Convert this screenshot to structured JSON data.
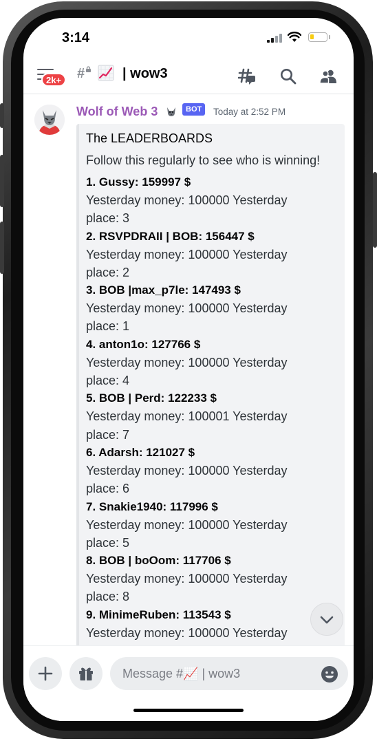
{
  "status_bar": {
    "time": "3:14",
    "battery_level": 0.25
  },
  "header": {
    "menu_badge": "2k+",
    "channel_hash": "#",
    "channel_emoji": "chart-increasing-icon",
    "channel_name": "| wow3",
    "icons": [
      "threads-icon",
      "search-icon",
      "members-icon"
    ]
  },
  "message": {
    "author": "Wolf of Web 3",
    "author_color": "#9b59b6",
    "author_emoji": "wolf-icon",
    "bot_tag": "BOT",
    "timestamp": "Today at 2:52 PM",
    "embed": {
      "title": "The LEADERBOARDS",
      "description": "Follow this regularly to see who is winning!",
      "entries": [
        {
          "name": "1. Gussy: 159997 $",
          "detail": "Yesterday money:  100000 Yesterday place:  3"
        },
        {
          "name": "2. RSVPDRAII | BOB: 156447 $",
          "detail": "Yesterday money:  100000 Yesterday place:  2"
        },
        {
          "name": "3. BOB |max_p7le: 147493 $",
          "detail": "Yesterday money:  100000 Yesterday place:  1"
        },
        {
          "name": "4. anton1o: 127766 $",
          "detail": "Yesterday money:  100000 Yesterday place:  4"
        },
        {
          "name": "5. BOB | Perd: 122233 $",
          "detail": "Yesterday money:  100001 Yesterday place:  7"
        },
        {
          "name": "6. Adarsh: 121027 $",
          "detail": "Yesterday money:  100000 Yesterday place:  6"
        },
        {
          "name": "7. Snakie1940: 117996 $",
          "detail": "Yesterday money:  100000 Yesterday place:  5"
        },
        {
          "name": "8. BOB | boOom: 117706 $",
          "detail": "Yesterday money:  100000 Yesterday place:  8"
        },
        {
          "name": "9. MinimeRuben: 113543 $",
          "detail": "Yesterday money:  100000 Yesterday"
        }
      ]
    }
  },
  "composer": {
    "placeholder": "Message #📈 | wow3",
    "buttons": [
      "plus-icon",
      "gift-icon",
      "emoji-icon"
    ]
  },
  "scroll_button_icon": "chevron-down-icon",
  "colors": {
    "accent": "#5865f2",
    "badge": "#ed4245",
    "battery": "#f7cc12"
  }
}
